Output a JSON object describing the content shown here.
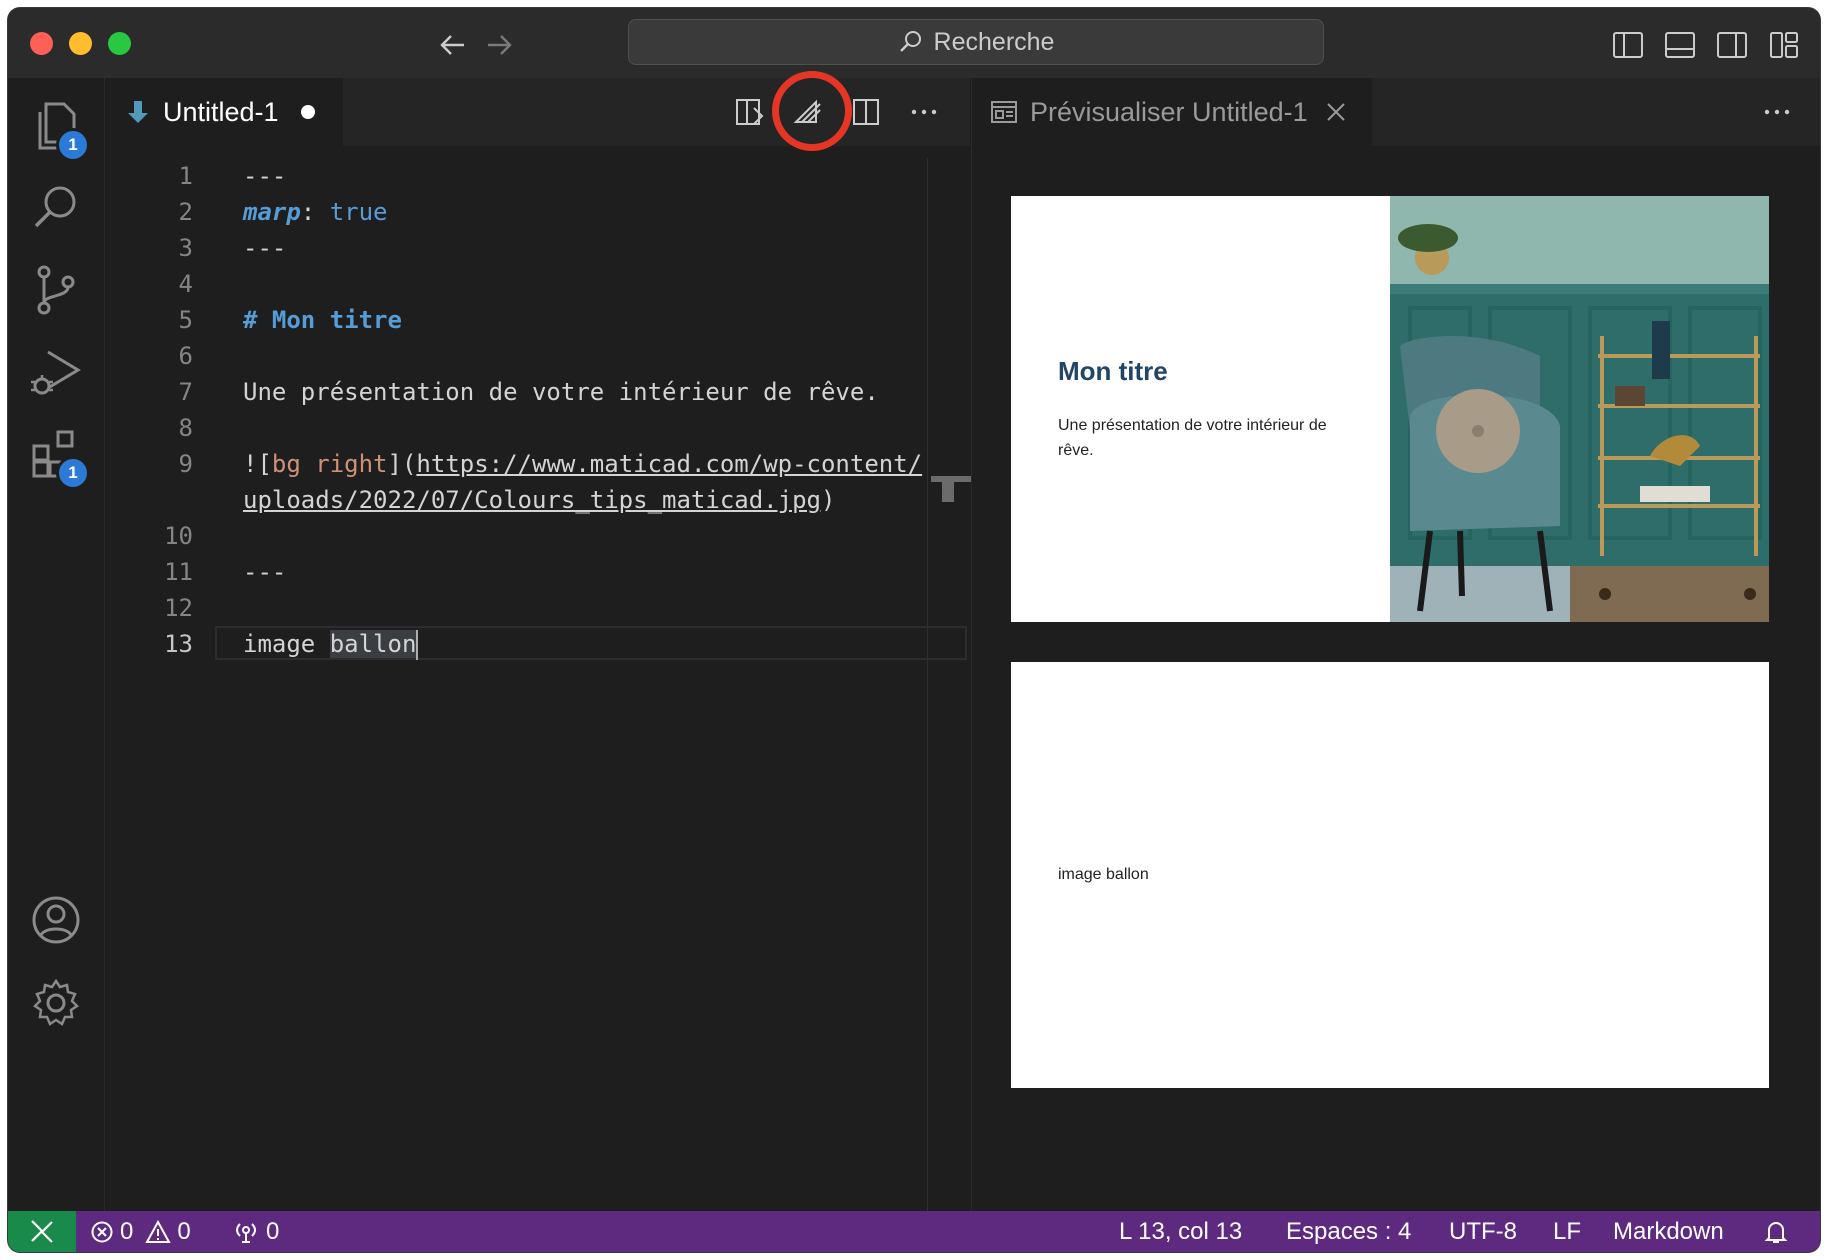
{
  "titlebar": {
    "search_text": "Recherche"
  },
  "activity": {
    "explorer_badge": "1",
    "extensions_badge": "1"
  },
  "editor": {
    "tab_title": "Untitled-1",
    "lines": {
      "l1": "1",
      "l2": "2",
      "l3": "3",
      "l4": "4",
      "l5": "5",
      "l6": "6",
      "l7": "7",
      "l8": "8",
      "l9": "9",
      "l10": "10",
      "l11": "11",
      "l12": "12",
      "l13": "13"
    },
    "code": {
      "fm_open": "---",
      "key": "marp",
      "colon": ": ",
      "value": "true",
      "fm_close": "---",
      "heading": "# Mon titre",
      "paragraph": "Une présentation de votre intérieur de rêve.",
      "img_prefix": "![",
      "img_alt": "bg right",
      "img_mid": "](",
      "img_url_1": "https://www.maticad.com/wp-content/",
      "img_url_2": "uploads/2022/07/Colours_tips_maticad.jpg",
      "img_suffix": ")",
      "slide_sep": "---",
      "last_prefix": "image ",
      "last_selected": "ballon"
    }
  },
  "preview": {
    "tab_title": "Prévisualiser Untitled-1",
    "slide1_title": "Mon titre",
    "slide1_text": "Une présentation de votre intérieur de rêve.",
    "slide2_text": "image ballon"
  },
  "status": {
    "errors": "0",
    "warnings": "0",
    "ports": "0",
    "position": "L 13, col 13",
    "indent": "Espaces : 4",
    "encoding": "UTF-8",
    "eol": "LF",
    "language": "Markdown"
  },
  "colors": {
    "statusbar": "#5e2a80",
    "remote": "#1a8a4a",
    "highlight": "#e53524",
    "badge": "#2a7ad6",
    "slide_title": "#224466"
  },
  "icons": [
    "files-icon",
    "search-icon",
    "source-control-icon",
    "run-debug-icon",
    "extensions-icon",
    "account-icon",
    "settings-gear-icon",
    "open-preview-icon",
    "marp-icon",
    "split-editor-icon",
    "more-actions-icon",
    "preview-icon",
    "close-icon",
    "bell-icon",
    "error-icon",
    "warning-icon",
    "broadcast-icon",
    "remote-icon"
  ]
}
